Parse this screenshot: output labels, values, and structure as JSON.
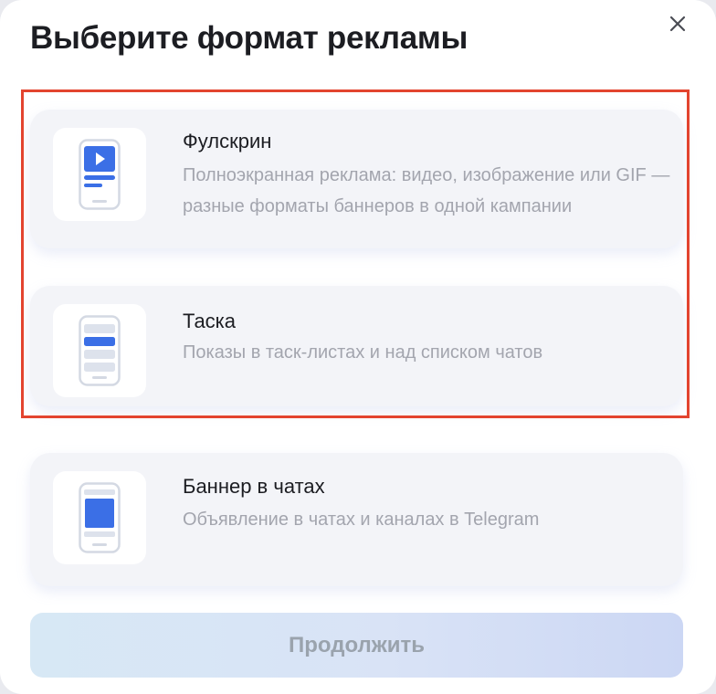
{
  "modal": {
    "title": "Выберите формат рекламы",
    "close_icon": "close-icon"
  },
  "formats": [
    {
      "title": "Фулскрин",
      "description": "Полноэкранная реклама: видео, изображение или GIF — разные форматы баннеров в одной кампании",
      "icon": "phone-video-icon"
    },
    {
      "title": "Таска",
      "description": "Показы в таск-листах и над списком чатов",
      "icon": "phone-list-icon"
    },
    {
      "title": "Баннер в чатах",
      "description": "Объявление в чатах и каналах в Telegram",
      "icon": "phone-banner-icon"
    }
  ],
  "continue_button": {
    "label": "Продолжить"
  },
  "colors": {
    "accent_blue": "#3b6fe6",
    "highlight_red": "#e3442f",
    "card_background": "#f3f4f8"
  }
}
